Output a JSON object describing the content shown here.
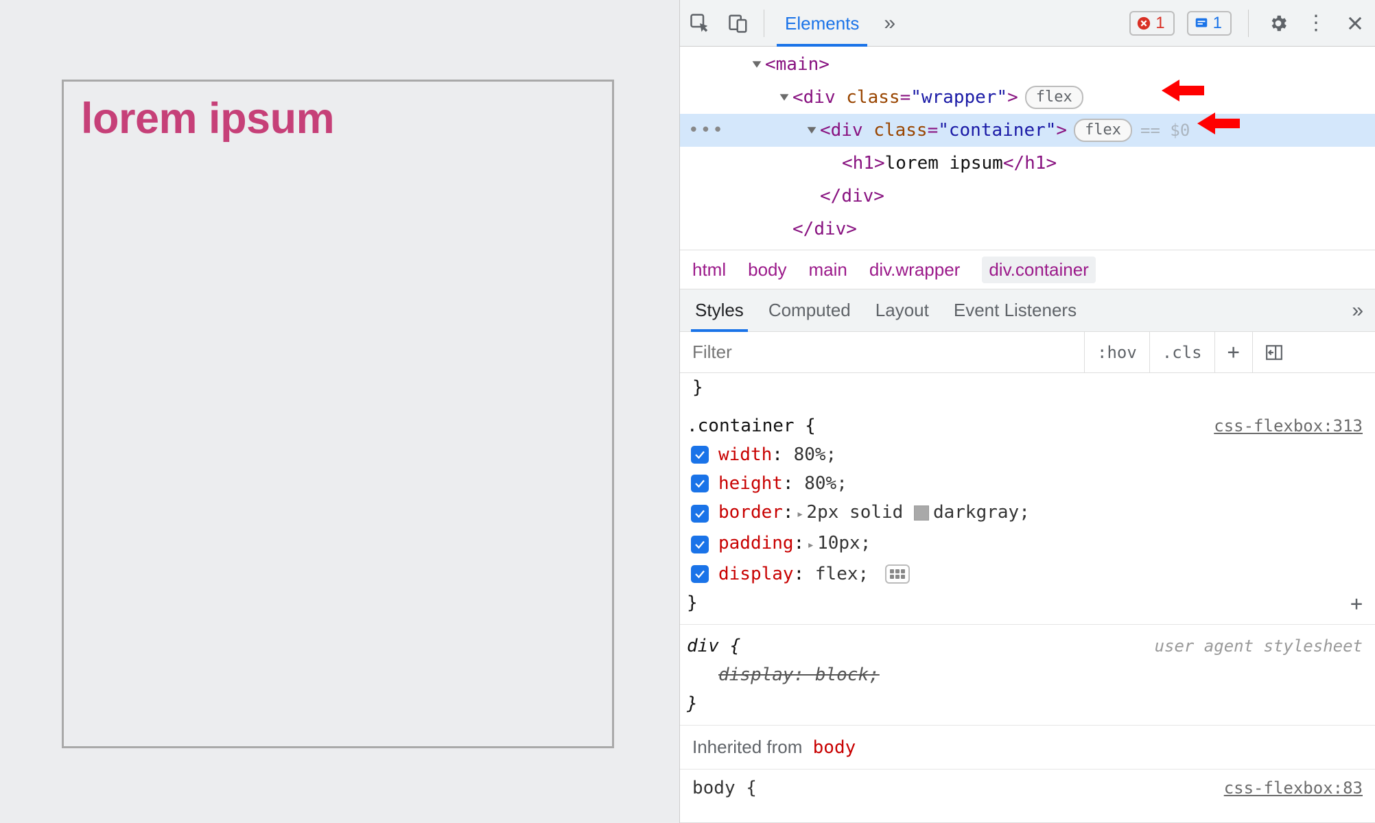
{
  "preview": {
    "heading": "lorem ipsum"
  },
  "toolbar": {
    "tab_elements": "Elements",
    "err_count": "1",
    "info_count": "1"
  },
  "dom": {
    "l1": {
      "open": "<",
      "tag": "main",
      "close": ">"
    },
    "l2": {
      "open": "<",
      "tag": "div",
      "attr": "class",
      "val": "\"wrapper\"",
      "close": ">",
      "pill": "flex"
    },
    "l3": {
      "open": "<",
      "tag": "div",
      "attr": "class",
      "val": "\"container\"",
      "close": ">",
      "pill": "flex",
      "sel_end": "== $0"
    },
    "l4": {
      "open": "<",
      "tag": "h1",
      "text": "lorem ipsum",
      "close_open": "</",
      "close_tag": "h1",
      "close_close": ">"
    },
    "l5": {
      "open": "</",
      "tag": "div",
      "close": ">"
    },
    "l6": {
      "open": "</",
      "tag": "div",
      "close": ">"
    }
  },
  "breadcrumbs": {
    "b1": "html",
    "b2": "body",
    "b3": "main",
    "b4": "div.wrapper",
    "b5": "div.container"
  },
  "subtabs": {
    "styles": "Styles",
    "computed": "Computed",
    "layout": "Layout",
    "events": "Event Listeners"
  },
  "filter": {
    "placeholder": "Filter",
    "hov": ":hov",
    "cls": ".cls",
    "plus": "+"
  },
  "rules": {
    "container": {
      "selector": ".container {",
      "src": "css-flexbox:313",
      "d1p": "width",
      "d1v": "80%;",
      "d2p": "height",
      "d2v": "80%;",
      "d3p": "border",
      "d3v": "2px solid ",
      "d3v2": "darkgray;",
      "d4p": "padding",
      "d4v": "10px;",
      "d5p": "display",
      "d5v": "flex;",
      "close": "}"
    },
    "div": {
      "selector": "div {",
      "src": "user agent stylesheet",
      "d1": "display: block;",
      "close": "}"
    },
    "inherited_label": "Inherited from",
    "inherited_from": "body",
    "body_peek_sel": "body {",
    "body_peek_src": "css-flexbox:83"
  }
}
